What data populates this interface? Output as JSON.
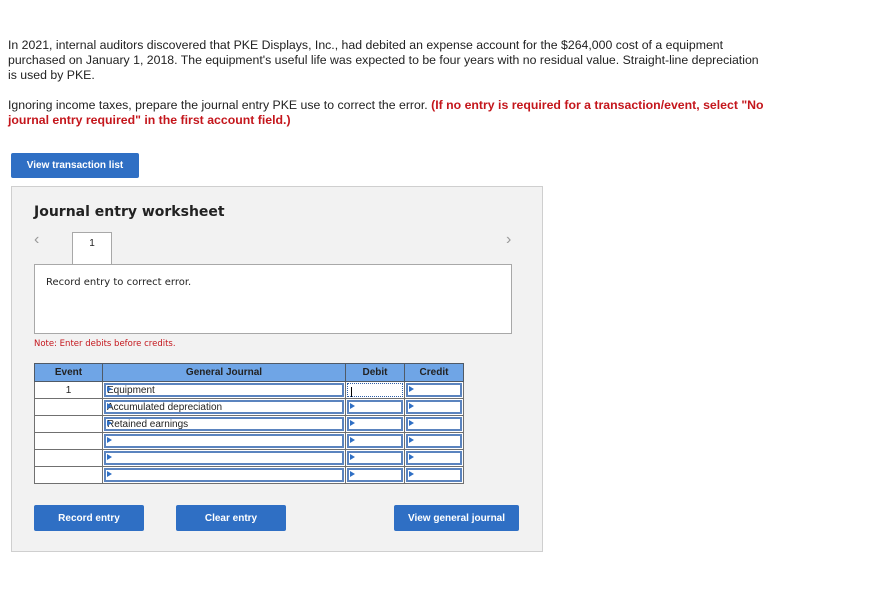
{
  "problem": {
    "paragraph1": "In 2021, internal auditors discovered that PKE Displays, Inc., had debited an expense account for the $264,000 cost of a equipment purchased on January 1, 2018. The equipment's useful life was expected to be four years with no residual value. Straight-line depreciation is used by PKE.",
    "paragraph2_plain": "Ignoring income taxes, prepare the journal entry PKE use to correct the error. ",
    "paragraph2_red": "(If no entry is required for a transaction/event, select \"No journal entry required\" in the first account field.)"
  },
  "buttons": {
    "view_transaction_list": "View transaction list",
    "record_entry": "Record entry",
    "clear_entry": "Clear entry",
    "view_general_journal": "View general journal"
  },
  "worksheet": {
    "title": "Journal entry worksheet",
    "prev_icon": "‹",
    "next_icon": "›",
    "tabs": [
      {
        "label": "1",
        "active": true
      }
    ],
    "description": "Record entry to correct error.",
    "note": "Note: Enter debits before credits."
  },
  "journal_table": {
    "headers": {
      "event": "Event",
      "general_journal": "General Journal",
      "debit": "Debit",
      "credit": "Credit"
    },
    "rows": [
      {
        "event": "1",
        "account": "Equipment",
        "debit": "",
        "credit": ""
      },
      {
        "event": "",
        "account": "Accumulated depreciation",
        "debit": "",
        "credit": ""
      },
      {
        "event": "",
        "account": "Retained earnings",
        "debit": "",
        "credit": ""
      },
      {
        "event": "",
        "account": "",
        "debit": "",
        "credit": ""
      },
      {
        "event": "",
        "account": "",
        "debit": "",
        "credit": ""
      },
      {
        "event": "",
        "account": "",
        "debit": "",
        "credit": ""
      }
    ]
  },
  "colors": {
    "button_blue": "#2f6fc4",
    "header_blue": "#6fa5e6",
    "instruction_red": "#c4161c",
    "panel_bg": "#f2f2f2"
  }
}
